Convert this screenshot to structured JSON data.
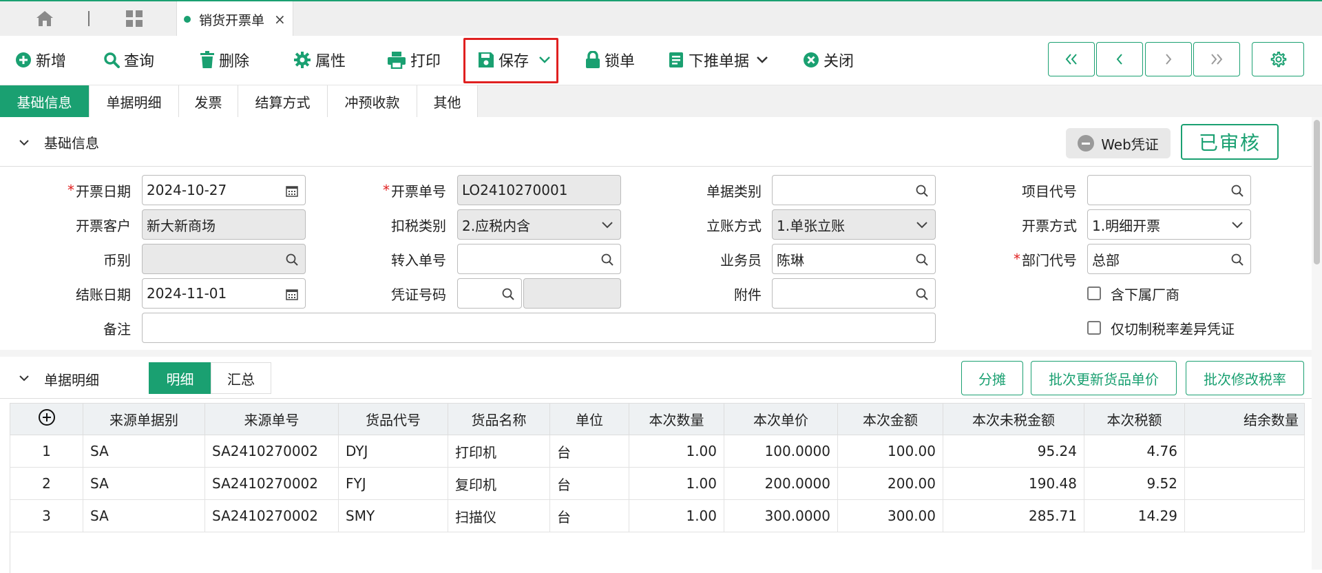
{
  "tabbar": {
    "doc_tab_label": "销货开票单",
    "close_glyph": "×"
  },
  "toolbar": {
    "new": "新增",
    "query": "查询",
    "delete": "删除",
    "properties": "属性",
    "print": "打印",
    "save": "保存",
    "lock": "锁单",
    "push_down": "下推单据",
    "close": "关闭"
  },
  "section_tabs": [
    "基础信息",
    "单据明细",
    "发票",
    "结算方式",
    "冲预收款",
    "其他"
  ],
  "basic_info": {
    "title": "基础信息",
    "web_voucher": "Web凭证",
    "status": "已审核"
  },
  "form": {
    "invoice_date_label": "开票日期",
    "invoice_date": "2024-10-27",
    "invoice_no_label": "开票单号",
    "invoice_no": "LO2410270001",
    "doc_type_label": "单据类别",
    "doc_type": "",
    "project_code_label": "项目代号",
    "project_code": "",
    "customer_label": "开票客户",
    "customer": "新大新商场",
    "tax_type_label": "扣税类别",
    "tax_type": "2.应税内含",
    "account_mode_label": "立账方式",
    "account_mode": "1.单张立账",
    "invoice_mode_label": "开票方式",
    "invoice_mode": "1.明细开票",
    "currency_label": "币别",
    "currency": "",
    "transfer_no_label": "转入单号",
    "transfer_no": "",
    "salesperson_label": "业务员",
    "salesperson": "陈琳",
    "dept_code_label": "部门代号",
    "dept_code": "总部",
    "close_date_label": "结账日期",
    "close_date": "2024-11-01",
    "voucher_no_label": "凭证号码",
    "voucher_no": "",
    "voucher_no2": "",
    "attachment_label": "附件",
    "attachment": "",
    "include_sub_vendor": "含下属厂商",
    "only_tax_diff_voucher": "仅切制税率差异凭证",
    "remark_label": "备注",
    "remark": ""
  },
  "detail": {
    "title": "单据明细",
    "seg_detail": "明细",
    "seg_summary": "汇总",
    "btn_allocate": "分摊",
    "btn_batch_price": "批次更新货品单价",
    "btn_batch_tax": "批次修改税率",
    "columns": [
      "来源单据别",
      "来源单号",
      "货品代号",
      "货品名称",
      "单位",
      "本次数量",
      "本次单价",
      "本次金额",
      "本次未税金额",
      "本次税额",
      "结余数量"
    ],
    "rows": [
      {
        "idx": "1",
        "src_type": "SA",
        "src_no": "SA2410270002",
        "code": "DYJ",
        "name": "打印机",
        "unit": "台",
        "qty": "1.00",
        "price": "100.0000",
        "amount": "100.00",
        "untaxed": "95.24",
        "tax": "4.76",
        "balance": ""
      },
      {
        "idx": "2",
        "src_type": "SA",
        "src_no": "SA2410270002",
        "code": "FYJ",
        "name": "复印机",
        "unit": "台",
        "qty": "1.00",
        "price": "200.0000",
        "amount": "200.00",
        "untaxed": "190.48",
        "tax": "9.52",
        "balance": ""
      },
      {
        "idx": "3",
        "src_type": "SA",
        "src_no": "SA2410270002",
        "code": "SMY",
        "name": "扫描仪",
        "unit": "台",
        "qty": "1.00",
        "price": "300.0000",
        "amount": "300.00",
        "untaxed": "285.71",
        "tax": "14.29",
        "balance": ""
      }
    ]
  },
  "colors": {
    "accent": "#1aa071",
    "highlight_box": "#e02020"
  }
}
